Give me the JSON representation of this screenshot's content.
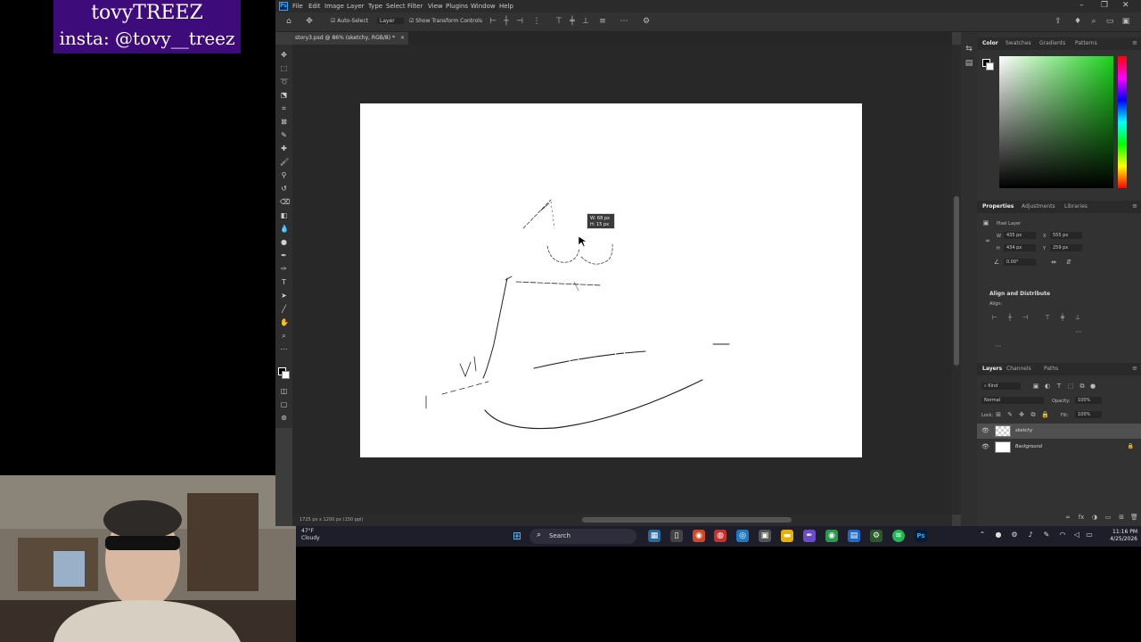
{
  "overlay": {
    "line1": "tovyTREEZ",
    "line2": "insta: @tovy__treez"
  },
  "menu": {
    "items": [
      "File",
      "Edit",
      "Image",
      "Layer",
      "Type",
      "Select",
      "Filter",
      "View",
      "Plugins",
      "Window",
      "Help"
    ]
  },
  "options_bar": {
    "auto_select": "Auto-Select",
    "layer_dropdown": "Layer",
    "transform_controls": "Show Transform Controls"
  },
  "document": {
    "tab_title": "story3.psd @ 86% (sketchy, RGB/8) *",
    "status": "1725 px x 1200 px (150 ppi)"
  },
  "tooltip": {
    "w": "W: 68 px",
    "h": "H: 15 px"
  },
  "color_panel": {
    "tabs": [
      "Color",
      "Swatches",
      "Gradients",
      "Patterns"
    ],
    "active": "Color"
  },
  "properties_panel": {
    "tabs": [
      "Properties",
      "Adjustments",
      "Libraries"
    ],
    "title": "Pixel Layer",
    "w": "435 px",
    "h": "434 px",
    "x": "555 px",
    "y": "259 px",
    "angle": "0.00°",
    "align_title": "Align and Distribute",
    "align_label": "Align:"
  },
  "layers_panel": {
    "tabs": [
      "Layers",
      "Channels",
      "Paths"
    ],
    "filter": "Kind",
    "blend": "Normal",
    "opacity_label": "Opacity:",
    "opacity": "100%",
    "lock_label": "Lock:",
    "fill_label": "Fill:",
    "fill": "100%",
    "layers": [
      {
        "name": "sketchy",
        "selected": true
      },
      {
        "name": "Background",
        "selected": false
      }
    ]
  },
  "taskbar": {
    "weather_temp": "47°F",
    "weather_desc": "Cloudy",
    "search": "Search",
    "time": "11:16 PM",
    "date": "4/25/2026"
  },
  "colors": {
    "accent": "#31a8ff",
    "banner": "#3d0b7a"
  }
}
